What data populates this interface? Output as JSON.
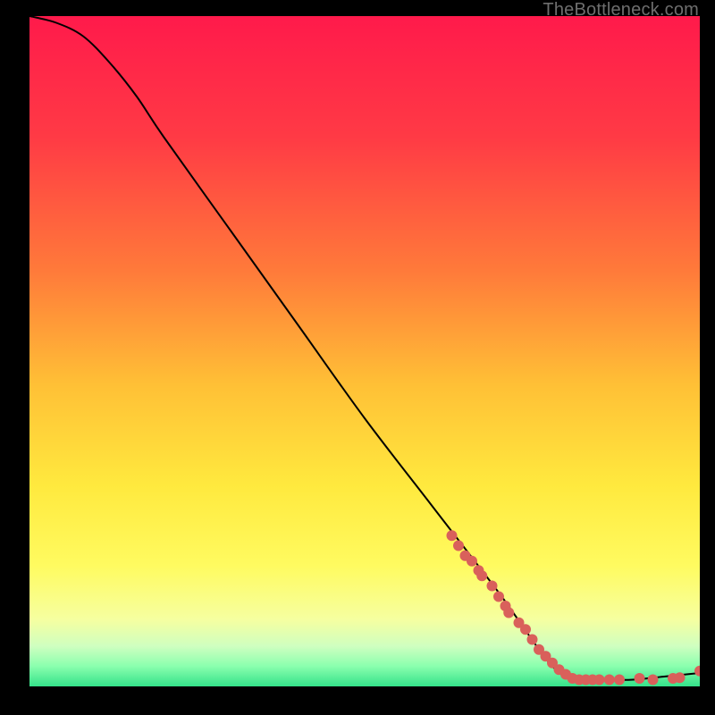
{
  "watermark": "TheBottleneck.com",
  "chart_data": {
    "type": "line",
    "title": "",
    "xlabel": "",
    "ylabel": "",
    "xlim": [
      0,
      100
    ],
    "ylim": [
      0,
      100
    ],
    "gradient_stops": [
      {
        "offset": 0,
        "color": "#ff1a4b"
      },
      {
        "offset": 18,
        "color": "#ff3a45"
      },
      {
        "offset": 38,
        "color": "#ff7a3a"
      },
      {
        "offset": 55,
        "color": "#ffc036"
      },
      {
        "offset": 70,
        "color": "#ffe93e"
      },
      {
        "offset": 82,
        "color": "#fffb60"
      },
      {
        "offset": 90,
        "color": "#f6ffa0"
      },
      {
        "offset": 94,
        "color": "#cfffc0"
      },
      {
        "offset": 97,
        "color": "#8affae"
      },
      {
        "offset": 100,
        "color": "#34e28a"
      }
    ],
    "series": [
      {
        "name": "curve",
        "color": "#000000",
        "points": [
          {
            "x": 0,
            "y": 100
          },
          {
            "x": 4,
            "y": 99
          },
          {
            "x": 8,
            "y": 97
          },
          {
            "x": 12,
            "y": 93
          },
          {
            "x": 16,
            "y": 88
          },
          {
            "x": 20,
            "y": 82
          },
          {
            "x": 30,
            "y": 68
          },
          {
            "x": 40,
            "y": 54
          },
          {
            "x": 50,
            "y": 40
          },
          {
            "x": 60,
            "y": 27
          },
          {
            "x": 70,
            "y": 14
          },
          {
            "x": 78,
            "y": 3
          },
          {
            "x": 82,
            "y": 1
          },
          {
            "x": 86,
            "y": 1
          },
          {
            "x": 90,
            "y": 1
          },
          {
            "x": 95,
            "y": 1.5
          },
          {
            "x": 100,
            "y": 2
          }
        ]
      }
    ],
    "markers": {
      "name": "highlighted-points",
      "color": "#d9605b",
      "radius": 6,
      "points": [
        {
          "x": 63,
          "y": 22.5
        },
        {
          "x": 64,
          "y": 21.0
        },
        {
          "x": 65,
          "y": 19.5
        },
        {
          "x": 66,
          "y": 18.7
        },
        {
          "x": 67,
          "y": 17.3
        },
        {
          "x": 67.5,
          "y": 16.5
        },
        {
          "x": 69,
          "y": 15
        },
        {
          "x": 70,
          "y": 13.4
        },
        {
          "x": 71,
          "y": 12
        },
        {
          "x": 71.5,
          "y": 11
        },
        {
          "x": 73,
          "y": 9.5
        },
        {
          "x": 74,
          "y": 8.5
        },
        {
          "x": 75,
          "y": 7
        },
        {
          "x": 76,
          "y": 5.5
        },
        {
          "x": 77,
          "y": 4.5
        },
        {
          "x": 78,
          "y": 3.5
        },
        {
          "x": 79,
          "y": 2.5
        },
        {
          "x": 80,
          "y": 1.8
        },
        {
          "x": 81,
          "y": 1.2
        },
        {
          "x": 82,
          "y": 1.0
        },
        {
          "x": 83,
          "y": 1.0
        },
        {
          "x": 84,
          "y": 1.0
        },
        {
          "x": 85,
          "y": 1.0
        },
        {
          "x": 86.5,
          "y": 1.0
        },
        {
          "x": 88,
          "y": 1.0
        },
        {
          "x": 91,
          "y": 1.2
        },
        {
          "x": 93,
          "y": 1.0
        },
        {
          "x": 96,
          "y": 1.2
        },
        {
          "x": 97,
          "y": 1.3
        },
        {
          "x": 100,
          "y": 2.3
        }
      ]
    }
  }
}
